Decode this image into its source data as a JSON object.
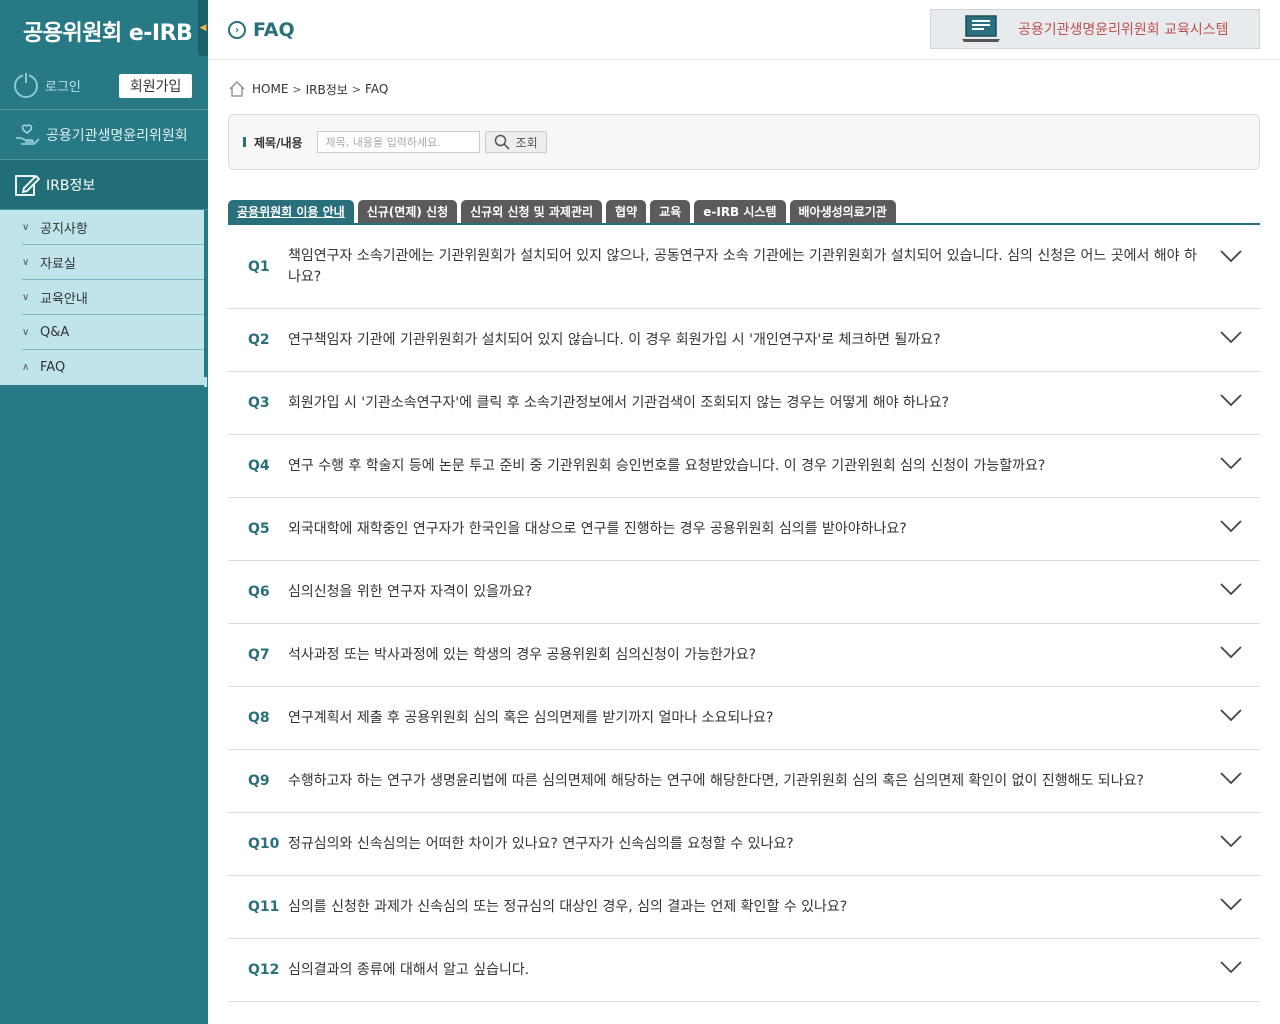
{
  "sidebar": {
    "logo": "공용위원회 e-IRB",
    "login": "로그인",
    "signup": "회원가입",
    "menu": [
      {
        "label": "공용기관생명윤리위원회"
      },
      {
        "label": "IRB정보"
      }
    ],
    "submenu": [
      {
        "label": "공지사항"
      },
      {
        "label": "자료실"
      },
      {
        "label": "교육안내"
      },
      {
        "label": "Q&A"
      },
      {
        "label": "FAQ"
      }
    ]
  },
  "header": {
    "title": "FAQ",
    "banner": "공용기관생명윤리위원회 교육시스템"
  },
  "breadcrumb": [
    "HOME",
    "IRB정보",
    "FAQ"
  ],
  "search": {
    "label": "제목/내용",
    "placeholder": "제목, 내용을 입력하세요.",
    "button": "조회"
  },
  "tabs": [
    "공용위원회 이용 안내",
    "신규(면제) 신청",
    "신규외 신청 및 과제관리",
    "협약",
    "교육",
    "e-IRB 시스템",
    "배아생성의료기관"
  ],
  "faq": [
    {
      "num": "Q1",
      "text": "책임연구자 소속기관에는 기관위원회가 설치되어 있지 않으나, 공동연구자 소속 기관에는 기관위원회가 설치되어 있습니다. 심의 신청은 어느 곳에서 해야 하나요?"
    },
    {
      "num": "Q2",
      "text": "연구책임자 기관에 기관위원회가 설치되어 있지 않습니다. 이 경우 회원가입 시 '개인연구자'로 체크하면 될까요?"
    },
    {
      "num": "Q3",
      "text": "회원가입 시 '기관소속연구자'에 클릭 후 소속기관정보에서 기관검색이 조회되지 않는 경우는 어떻게 해야 하나요?"
    },
    {
      "num": "Q4",
      "text": "연구 수행 후 학술지 등에 논문 투고 준비 중 기관위원회 승인번호를 요청받았습니다. 이 경우 기관위원회 심의 신청이 가능할까요?"
    },
    {
      "num": "Q5",
      "text": "외국대학에 재학중인 연구자가 한국인을 대상으로 연구를 진행하는 경우 공용위원회 심의를 받아야하나요?"
    },
    {
      "num": "Q6",
      "text": "심의신청을 위한 연구자 자격이 있을까요?"
    },
    {
      "num": "Q7",
      "text": "석사과정 또는 박사과정에 있는 학생의 경우 공용위원회 심의신청이 가능한가요?"
    },
    {
      "num": "Q8",
      "text": "연구계획서 제출 후 공용위원회 심의 혹은 심의면제를 받기까지 얼마나 소요되나요?"
    },
    {
      "num": "Q9",
      "text": "수행하고자 하는 연구가 생명윤리법에 따른 심의면제에 해당하는 연구에 해당한다면, 기관위원회 심의 혹은 심의면제 확인이 없이 진행해도 되나요?"
    },
    {
      "num": "Q10",
      "text": "정규심의와 신속심의는 어떠한 차이가 있나요? 연구자가 신속심의를 요청할 수 있나요?"
    },
    {
      "num": "Q11",
      "text": "심의를 신청한 과제가 신속심의 또는 정규심의 대상인 경우, 심의 결과는 언제 확인할 수 있나요?"
    },
    {
      "num": "Q12",
      "text": "심의결과의 종류에 대해서 알고 싶습니다."
    }
  ]
}
